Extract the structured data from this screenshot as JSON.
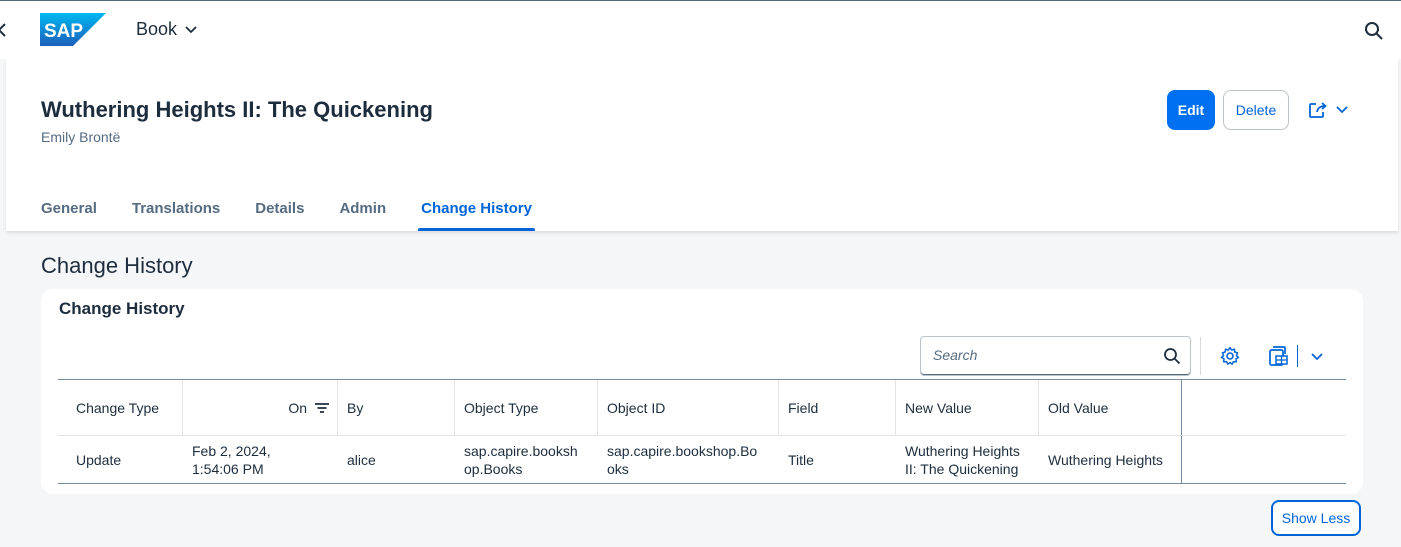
{
  "shell": {
    "logo_text": "SAP",
    "app_title": "Book",
    "colors": {
      "logo_blue": "#0a6ed1",
      "accent": "#0064d9",
      "button_primary": "#0070f2"
    }
  },
  "header": {
    "title": "Wuthering Heights II: The Quickening",
    "subtitle": "Emily Brontë",
    "edit_label": "Edit",
    "delete_label": "Delete",
    "tabs": [
      {
        "label": "General"
      },
      {
        "label": "Translations"
      },
      {
        "label": "Details"
      },
      {
        "label": "Admin"
      },
      {
        "label": "Change History",
        "active": true
      }
    ]
  },
  "section": {
    "title": "Change History",
    "card_title": "Change History",
    "search_placeholder": "Search",
    "columns": [
      "Change Type",
      "On",
      "By",
      "Object Type",
      "Object ID",
      "Field",
      "New Value",
      "Old Value"
    ],
    "rows": [
      {
        "change_type": "Update",
        "on_line1": "Feb 2, 2024,",
        "on_line2": "1:54:06 PM",
        "by": "alice",
        "object_type_line1": "sap.capire.booksh",
        "object_type_line2": "op.Books",
        "object_id_line1": "sap.capire.bookshop.Bo",
        "object_id_line2": "oks",
        "field": "Title",
        "new_value_line1": "Wuthering Heights",
        "new_value_line2": "II: The Quickening",
        "old_value": "Wuthering Heights"
      }
    ],
    "show_less_label": "Show Less"
  },
  "icons": [
    "back-icon",
    "chevron-down-icon",
    "search-icon",
    "share-icon",
    "sort-icon",
    "settings-icon",
    "export-icon"
  ]
}
